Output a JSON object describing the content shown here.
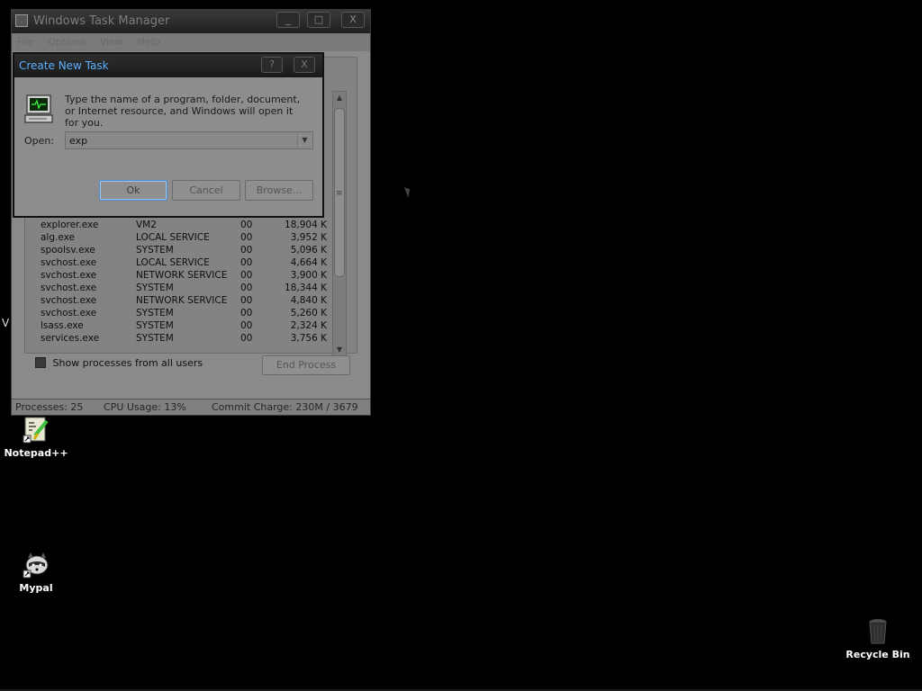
{
  "desktop": {
    "icons": [
      {
        "label": "Notepad++",
        "icon": "notepad-plus-plus-icon"
      },
      {
        "label": "Mypal",
        "icon": "mypal-raccoon-icon"
      },
      {
        "label": "Recycle Bin",
        "icon": "recycle-bin-icon"
      }
    ],
    "edge_letter": "V"
  },
  "task_manager": {
    "title": "Windows Task Manager",
    "menu": [
      "File",
      "Options",
      "View",
      "Help"
    ],
    "window_buttons": [
      "_",
      "□",
      "X"
    ],
    "processes": [
      {
        "name": "explorer.exe",
        "user": "VM2",
        "cpu": "00",
        "mem": "18,904 K"
      },
      {
        "name": "alg.exe",
        "user": "LOCAL SERVICE",
        "cpu": "00",
        "mem": "3,952 K"
      },
      {
        "name": "spoolsv.exe",
        "user": "SYSTEM",
        "cpu": "00",
        "mem": "5,096 K"
      },
      {
        "name": "svchost.exe",
        "user": "LOCAL SERVICE",
        "cpu": "00",
        "mem": "4,664 K"
      },
      {
        "name": "svchost.exe",
        "user": "NETWORK SERVICE",
        "cpu": "00",
        "mem": "3,900 K"
      },
      {
        "name": "svchost.exe",
        "user": "SYSTEM",
        "cpu": "00",
        "mem": "18,344 K"
      },
      {
        "name": "svchost.exe",
        "user": "NETWORK SERVICE",
        "cpu": "00",
        "mem": "4,840 K"
      },
      {
        "name": "svchost.exe",
        "user": "SYSTEM",
        "cpu": "00",
        "mem": "5,260 K"
      },
      {
        "name": "lsass.exe",
        "user": "SYSTEM",
        "cpu": "00",
        "mem": "2,324 K"
      },
      {
        "name": "services.exe",
        "user": "SYSTEM",
        "cpu": "00",
        "mem": "3,756 K"
      }
    ],
    "show_all_label": "Show processes from all users",
    "end_process_label": "End Process",
    "status": {
      "processes": "Processes: 25",
      "cpu": "CPU Usage: 13%",
      "commit": "Commit Charge: 230M / 3679"
    }
  },
  "run_dialog": {
    "title": "Create New Task",
    "window_buttons": [
      "?",
      "X"
    ],
    "description": "Type the name of a program, folder, document, or Internet resource, and Windows will open it for you.",
    "open_label": "Open:",
    "open_value": "exp",
    "ok_label": "Ok",
    "cancel_label": "Cancel",
    "browse_label": "Browse..."
  },
  "colors": {
    "desktop_bg": "#000000",
    "dialog_title_text": "#5cb0ff",
    "focus_border": "#4a8fd0"
  }
}
